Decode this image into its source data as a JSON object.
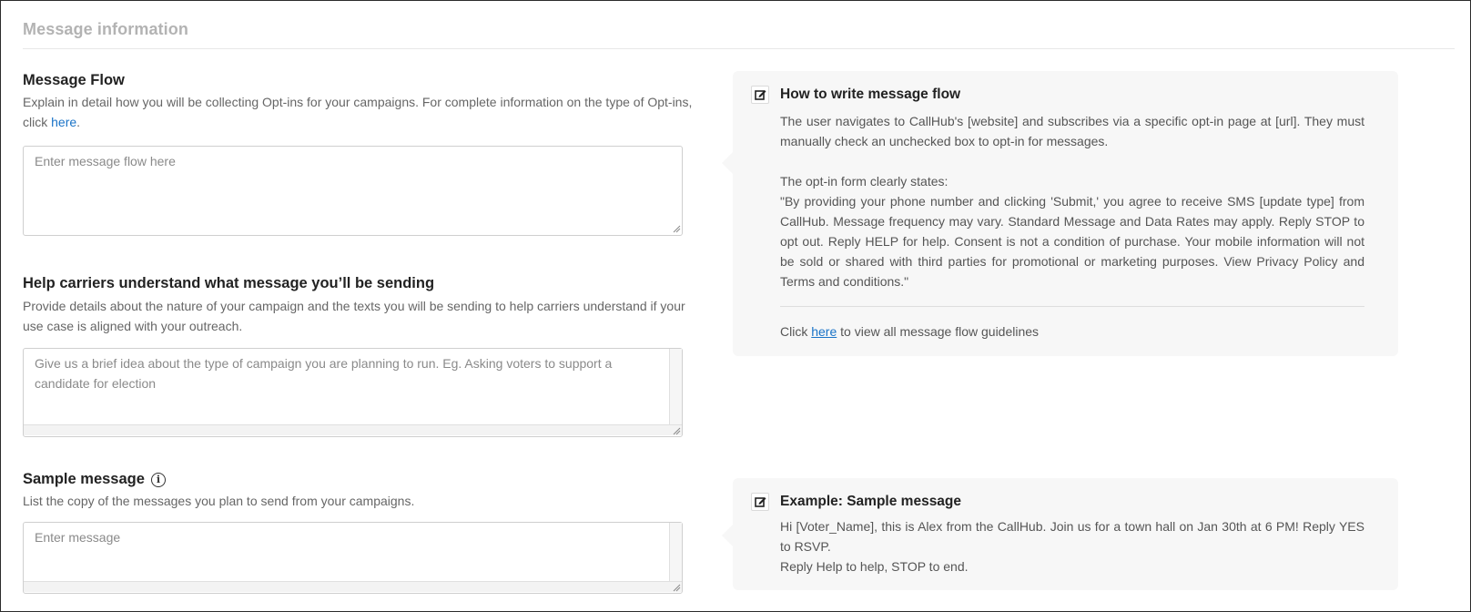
{
  "section": {
    "title": "Message information"
  },
  "message_flow": {
    "title": "Message Flow",
    "description": "Explain in detail how you will be collecting Opt-ins for your campaigns. For complete information on the type of Opt-ins, click",
    "link_text": "here",
    "link_suffix": ".",
    "placeholder": "Enter message flow here"
  },
  "help_carriers": {
    "title": "Help carriers understand what message you’ll be sending",
    "description": "Provide details about the nature of your campaign and the texts you will be sending to help carriers understand if your use case is aligned with your outreach.",
    "placeholder": "Give us a brief idea about the type of campaign you are planning to run. Eg. Asking voters to support a candidate for election"
  },
  "sample_message": {
    "title": "Sample message",
    "info_icon": "info-icon",
    "description": "List the copy of the messages you plan to send from your campaigns.",
    "placeholder": "Enter message"
  },
  "flow_card": {
    "icon": "edit-icon",
    "title": "How to write message flow",
    "para1": "The user navigates to CallHub's [website] and subscribes via a specific opt-in page at [url]. They must manually check an unchecked box to opt-in for messages.",
    "para2_heading": "The opt-in form clearly states:",
    "para2": "\"By providing your phone number and clicking 'Submit,' you agree to receive SMS [update type] from CallHub. Message frequency may vary. Standard Message and Data Rates may apply. Reply STOP to opt out. Reply HELP for help. Consent is not a condition of purchase. Your mobile information will not be sold or shared with third parties for promotional or marketing purposes. View Privacy Policy and Terms and conditions.\"",
    "footer_prefix": "Click",
    "footer_link": "here",
    "footer_suffix": "to view all message flow guidelines"
  },
  "sample_card": {
    "icon": "edit-icon",
    "title": "Example: Sample message",
    "line1": "Hi [Voter_Name], this is Alex from the CallHub. Join us for a town hall on Jan 30th at 6 PM! Reply YES to RSVP.",
    "line2": "Reply Help to help, STOP to end."
  },
  "colors": {
    "link": "#1a73c7",
    "card_bg": "#f7f7f7",
    "muted": "#b3b3b3"
  }
}
